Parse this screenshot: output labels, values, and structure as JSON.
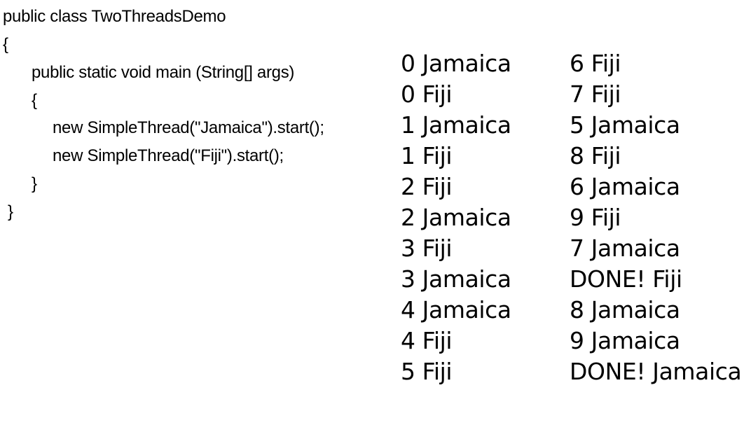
{
  "code": {
    "lines": [
      "public class TwoThreadsDemo",
      "{",
      "public static void main (String[] args)",
      "{",
      "new SimpleThread(\"Jamaica\").start();",
      "new SimpleThread(\"Fiji\").start();",
      "}",
      "}"
    ]
  },
  "output": {
    "col1": [
      "0 Jamaica",
      "0 Fiji",
      "1 Jamaica",
      "1 Fiji",
      "2 Fiji",
      "2 Jamaica",
      "3 Fiji",
      "3 Jamaica",
      "4 Jamaica",
      "4 Fiji",
      "5 Fiji"
    ],
    "col2": [
      "6 Fiji",
      "7 Fiji",
      "5 Jamaica",
      "8 Fiji",
      "6 Jamaica",
      "9 Fiji",
      "7 Jamaica",
      "DONE! Fiji",
      "8 Jamaica",
      "9 Jamaica",
      "DONE! Jamaica"
    ]
  }
}
